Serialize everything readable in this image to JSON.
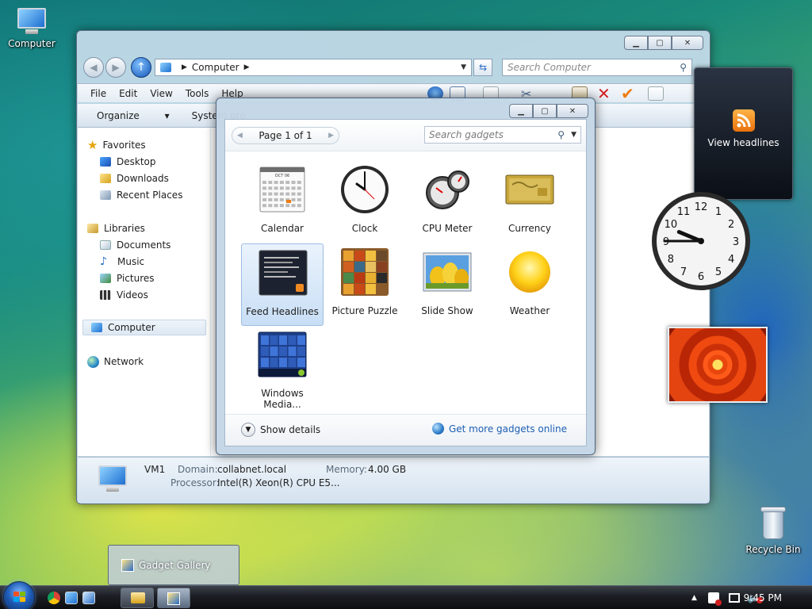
{
  "desktop": {
    "computer_label": "Computer",
    "recycle_label": "Recycle Bin"
  },
  "explorer": {
    "address": "Computer",
    "search_placeholder": "Search Computer",
    "menu": [
      "File",
      "Edit",
      "View",
      "Tools",
      "Help"
    ],
    "organize": "Organize",
    "system_props": "System pro",
    "nav": {
      "favorites": "Favorites",
      "desktop": "Desktop",
      "downloads": "Downloads",
      "recent": "Recent Places",
      "libraries": "Libraries",
      "documents": "Documents",
      "music": "Music",
      "pictures": "Pictures",
      "videos": "Videos",
      "computer": "Computer",
      "network": "Network"
    },
    "details": {
      "name": "VM1",
      "domain_label": "Domain:",
      "domain": "collabnet.local",
      "memory_label": "Memory:",
      "memory": "4.00 GB",
      "processor_label": "Processor:",
      "processor": "Intel(R) Xeon(R) CPU E5..."
    }
  },
  "gallery": {
    "page": "Page 1 of 1",
    "search_placeholder": "Search gadgets",
    "gadgets": [
      "Calendar",
      "Clock",
      "CPU Meter",
      "Currency",
      "Feed Headlines",
      "Picture Puzzle",
      "Slide Show",
      "Weather",
      "Windows Media..."
    ],
    "calendar_month": "OCT 06",
    "show_details": "Show details",
    "get_more": "Get more gadgets online"
  },
  "sidebar": {
    "feed_text": "View headlines",
    "clock_time": {
      "hour": 9,
      "minute": 45
    }
  },
  "taskbar": {
    "popup_title": "Gadget Gallery",
    "time": "9:45 PM"
  },
  "colors": {
    "accent": "#1c5eb4",
    "rss": "#e8700a"
  }
}
